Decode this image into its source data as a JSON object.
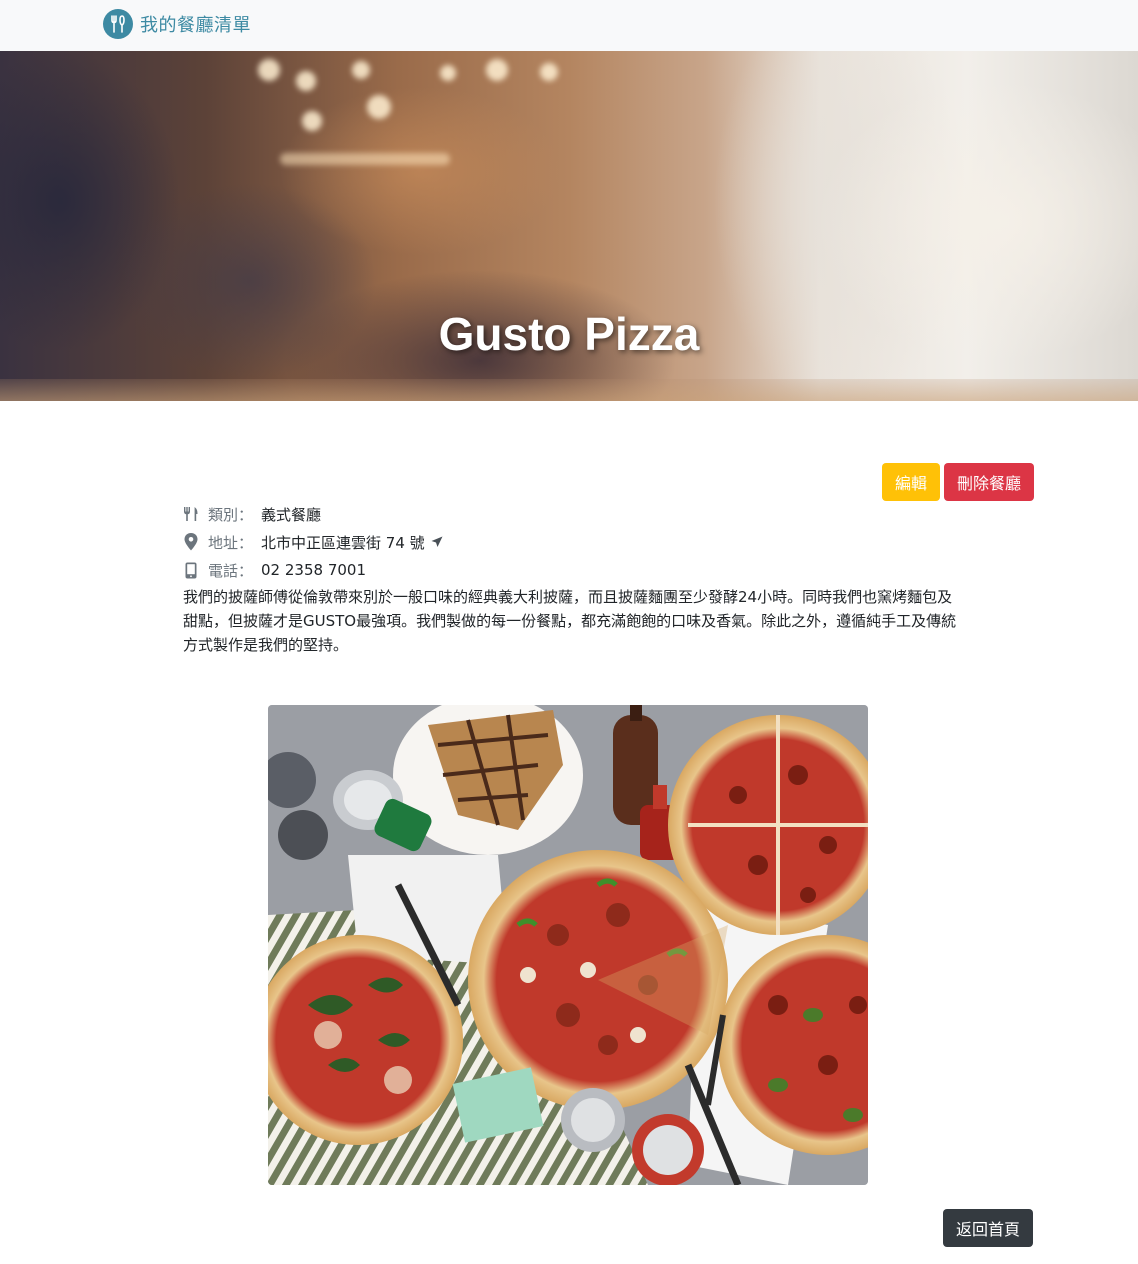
{
  "navbar": {
    "brand_text": "我的餐廳清單",
    "brand_icon": "utensils-icon"
  },
  "hero": {
    "title": "Gusto Pizza"
  },
  "actions": {
    "edit_label": "編輯",
    "delete_label": "刪除餐廳",
    "back_label": "返回首頁"
  },
  "info": {
    "category_label": "類別：",
    "category_value": "義式餐廳",
    "address_label": "地址：",
    "address_value": "北市中正區連雲街 74 號",
    "phone_label": "電話：",
    "phone_value": "02 2358 7001"
  },
  "description": "我們的披薩師傅從倫敦帶來別於一般口味的經典義大利披薩，而且披薩麵團至少發酵24小時。同時我們也窯烤麵包及甜點，但披薩才是GUSTO最強項。我們製做的每一份餐點，都充滿飽飽的口味及香氣。除此之外，遵循純手工及傳統方式製作是我們的堅持。",
  "colors": {
    "brand": "#3d8aa3",
    "warning": "#ffc107",
    "danger": "#dc3545",
    "dark": "#343a40"
  }
}
